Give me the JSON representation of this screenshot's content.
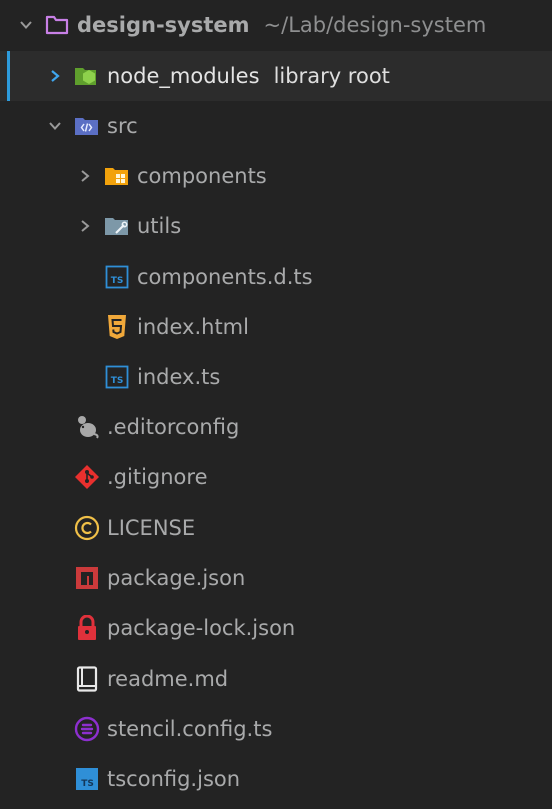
{
  "root": {
    "name": "design-system",
    "path": "~/Lab/design-system",
    "icon": "folder-outline-icon"
  },
  "rows": [
    {
      "label": "node_modules",
      "note": "library root",
      "icon": "node-modules-folder-icon",
      "selected": true
    },
    {
      "label": "src",
      "icon": "src-folder-icon"
    },
    {
      "label": "components",
      "icon": "components-folder-icon"
    },
    {
      "label": "utils",
      "icon": "utils-folder-icon"
    },
    {
      "label": "components.d.ts",
      "icon": "typescript-file-icon"
    },
    {
      "label": "index.html",
      "icon": "html5-file-icon"
    },
    {
      "label": "index.ts",
      "icon": "typescript-file-icon"
    },
    {
      "label": ".editorconfig",
      "icon": "editorconfig-mouse-icon"
    },
    {
      "label": ".gitignore",
      "icon": "git-icon"
    },
    {
      "label": "LICENSE",
      "icon": "copyright-icon"
    },
    {
      "label": "package.json",
      "icon": "npm-icon"
    },
    {
      "label": "package-lock.json",
      "icon": "lock-icon"
    },
    {
      "label": "readme.md",
      "icon": "readme-book-icon"
    },
    {
      "label": "stencil.config.ts",
      "icon": "stencil-icon"
    },
    {
      "label": "tsconfig.json",
      "icon": "tsconfig-icon"
    }
  ],
  "colors": {
    "background": "#232323",
    "selection_accent": "#2d9bdc",
    "typescript": "#2f8fd7",
    "html5": "#f0a83a",
    "git": "#e8302e",
    "npm": "#cb3a3b",
    "lock": "#e0313b",
    "stencil": "#8d2fcf",
    "node": "#7bc142",
    "root_folder": "#c880e6"
  }
}
